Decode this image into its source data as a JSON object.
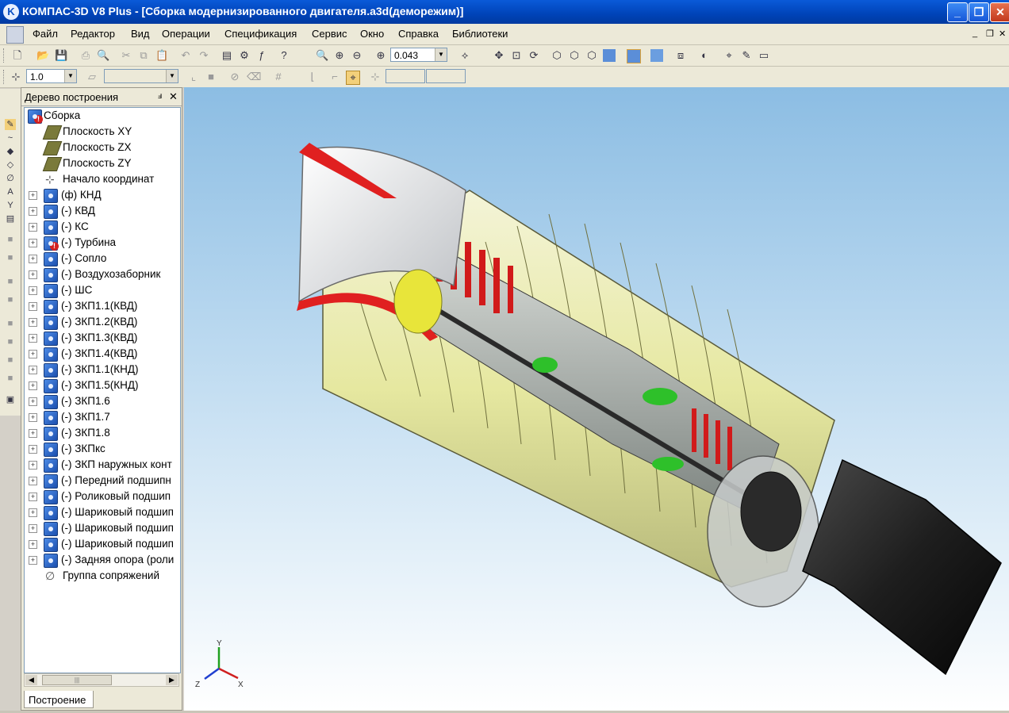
{
  "window": {
    "title": "КОМПАС-3D V8 Plus - [Сборка модернизированного двигателя.a3d(деморежим)]",
    "app_icon": "kompas-logo",
    "min_glyph": "_",
    "max_glyph": "❐",
    "close_glyph": "✕",
    "accent_color": "#0a5ad8"
  },
  "menu": {
    "items": [
      "Файл",
      "Редактор",
      "Вид",
      "Операции",
      "Спецификация",
      "Сервис",
      "Окно",
      "Справка",
      "Библиотеки"
    ],
    "doc_min": "_",
    "doc_restore": "❐",
    "doc_close": "✕"
  },
  "toolbar1": {
    "zoom_value": "0.043"
  },
  "toolbar2": {
    "step_value": "1.0"
  },
  "tree_panel": {
    "title": "Дерево построения",
    "pin_glyph": "ⅎ",
    "close_glyph": "✕",
    "tab_label": "Построение",
    "expander": "+",
    "scroll_left": "◀",
    "scroll_right": "▶",
    "scroll_thumb": "|||",
    "items": [
      {
        "label": "Сборка",
        "icon": "assembly-icon",
        "level": 0,
        "expandable": false,
        "warning": true
      },
      {
        "label": "Плоскость XY",
        "icon": "plane-icon",
        "level": 1,
        "expandable": false
      },
      {
        "label": "Плоскость ZX",
        "icon": "plane-icon",
        "level": 1,
        "expandable": false
      },
      {
        "label": "Плоскость ZY",
        "icon": "plane-icon",
        "level": 1,
        "expandable": false
      },
      {
        "label": "Начало координат",
        "icon": "origin-icon",
        "level": 1,
        "expandable": false
      },
      {
        "label": "(ф) КНД",
        "icon": "part-icon",
        "level": 1,
        "expandable": true
      },
      {
        "label": "(-) КВД",
        "icon": "part-icon",
        "level": 1,
        "expandable": true
      },
      {
        "label": "(-) КС",
        "icon": "part-icon",
        "level": 1,
        "expandable": true
      },
      {
        "label": "(-) Турбина",
        "icon": "part-icon",
        "level": 1,
        "expandable": true,
        "warning": true
      },
      {
        "label": "(-) Сопло",
        "icon": "part-icon",
        "level": 1,
        "expandable": true
      },
      {
        "label": "(-) Воздухозаборник",
        "icon": "part-icon",
        "level": 1,
        "expandable": true
      },
      {
        "label": "(-) ШС",
        "icon": "part-icon",
        "level": 1,
        "expandable": true
      },
      {
        "label": "(-) ЗКП1.1(КВД)",
        "icon": "part-icon",
        "level": 1,
        "expandable": true
      },
      {
        "label": "(-) ЗКП1.2(КВД)",
        "icon": "part-icon",
        "level": 1,
        "expandable": true
      },
      {
        "label": "(-) ЗКП1.3(КВД)",
        "icon": "part-icon",
        "level": 1,
        "expandable": true
      },
      {
        "label": "(-) ЗКП1.4(КВД)",
        "icon": "part-icon",
        "level": 1,
        "expandable": true
      },
      {
        "label": "(-) ЗКП1.1(КНД)",
        "icon": "part-icon",
        "level": 1,
        "expandable": true
      },
      {
        "label": "(-) ЗКП1.5(КНД)",
        "icon": "part-icon",
        "level": 1,
        "expandable": true
      },
      {
        "label": "(-) ЗКП1.6",
        "icon": "part-icon",
        "level": 1,
        "expandable": true
      },
      {
        "label": "(-) ЗКП1.7",
        "icon": "part-icon",
        "level": 1,
        "expandable": true
      },
      {
        "label": "(-) ЗКП1.8",
        "icon": "part-icon",
        "level": 1,
        "expandable": true
      },
      {
        "label": "(-) ЗКПкс",
        "icon": "part-icon",
        "level": 1,
        "expandable": true
      },
      {
        "label": "(-) ЗКП наружных конт",
        "icon": "part-icon",
        "level": 1,
        "expandable": true
      },
      {
        "label": "(-) Передний подшипн",
        "icon": "part-icon",
        "level": 1,
        "expandable": true
      },
      {
        "label": "(-) Роликовый подшип",
        "icon": "part-icon",
        "level": 1,
        "expandable": true
      },
      {
        "label": "(-) Шариковый подшип",
        "icon": "part-icon",
        "level": 1,
        "expandable": true
      },
      {
        "label": "(-) Шариковый подшип",
        "icon": "part-icon",
        "level": 1,
        "expandable": true
      },
      {
        "label": "(-) Шариковый подшип",
        "icon": "part-icon",
        "level": 1,
        "expandable": true
      },
      {
        "label": "(-) Задняя опора (роли",
        "icon": "part-icon",
        "level": 1,
        "expandable": true
      },
      {
        "label": "Группа сопряжений",
        "icon": "mates-icon",
        "level": 1,
        "expandable": false
      }
    ]
  },
  "viewport": {
    "axis_x": "X",
    "axis_y": "Y",
    "axis_z": "Z",
    "bg_top": "#8cbde3",
    "bg_bottom": "#ffffff"
  }
}
